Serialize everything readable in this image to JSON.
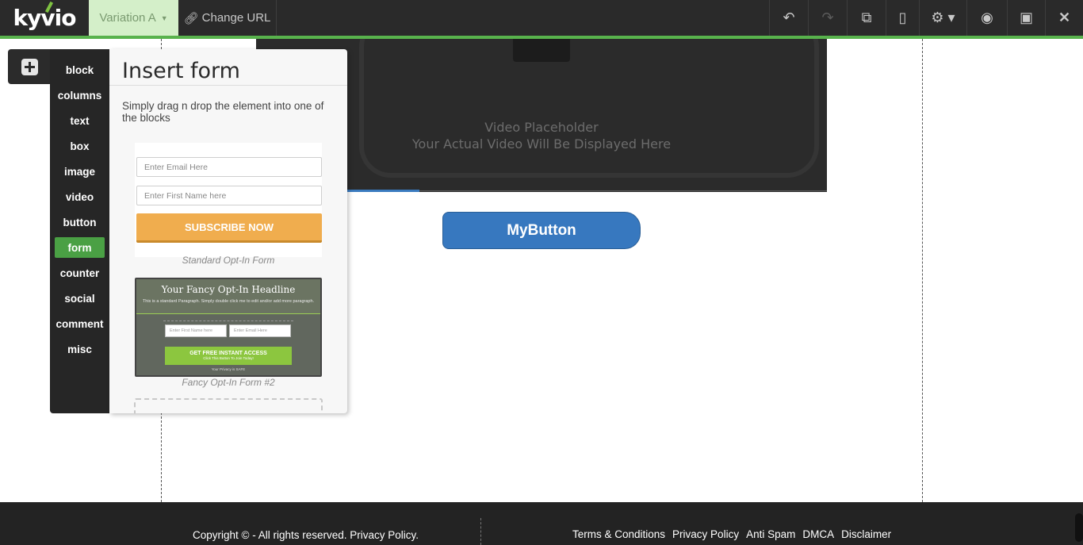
{
  "topbar": {
    "logo": "kyvio",
    "variation_label": "Variation A",
    "change_url_label": "Change URL",
    "tools": [
      {
        "name": "undo-icon",
        "glyph": "↶"
      },
      {
        "name": "redo-icon",
        "glyph": "↷"
      },
      {
        "name": "duplicate-icon",
        "glyph": "⧉"
      },
      {
        "name": "mobile-icon",
        "glyph": "▯"
      },
      {
        "name": "settings-gear-icon",
        "glyph": "⚙ ▾"
      },
      {
        "name": "preview-eye-icon",
        "glyph": "◉"
      },
      {
        "name": "save-icon",
        "glyph": "▣"
      },
      {
        "name": "close-icon",
        "glyph": "✕"
      }
    ],
    "accent_color": "#58b24c"
  },
  "sidebar": {
    "categories": [
      "block",
      "columns",
      "text",
      "box",
      "image",
      "video",
      "button",
      "form",
      "counter",
      "social",
      "comment",
      "misc"
    ],
    "active": "form"
  },
  "panel": {
    "title": "Insert form",
    "description": "Simply drag n drop the element into one of the blocks",
    "standard_form": {
      "email_placeholder": "Enter Email Here",
      "name_placeholder": "Enter First Name here",
      "submit_label": "SUBSCRIBE NOW",
      "caption": "Standard Opt-In Form"
    },
    "fancy_form": {
      "headline": "Your Fancy Opt-In Headline",
      "paragraph": "This is a standard Paragraph. Simply double click me to edit and/or add more paragraph.",
      "name_placeholder": "Enter First Name here",
      "email_placeholder": "Enter Email Here",
      "button_label": "GET FREE INSTANT ACCESS",
      "button_sub": "Click This Button To Join Today!",
      "privacy": "Your Privacy is SAFE",
      "caption": "Fancy Opt-In Form #2"
    }
  },
  "canvas": {
    "video_placeholder_line1": "Video Placeholder",
    "video_placeholder_line2": "Your Actual Video Will Be Displayed Here",
    "button_label": "MyButton",
    "button_color": "#3778bf"
  },
  "footer": {
    "copyright": "Copyright © - All rights reserved. Privacy Policy.",
    "links": [
      "Terms & Conditions",
      "Privacy Policy",
      "Anti Spam",
      "DMCA",
      "Disclaimer"
    ]
  }
}
